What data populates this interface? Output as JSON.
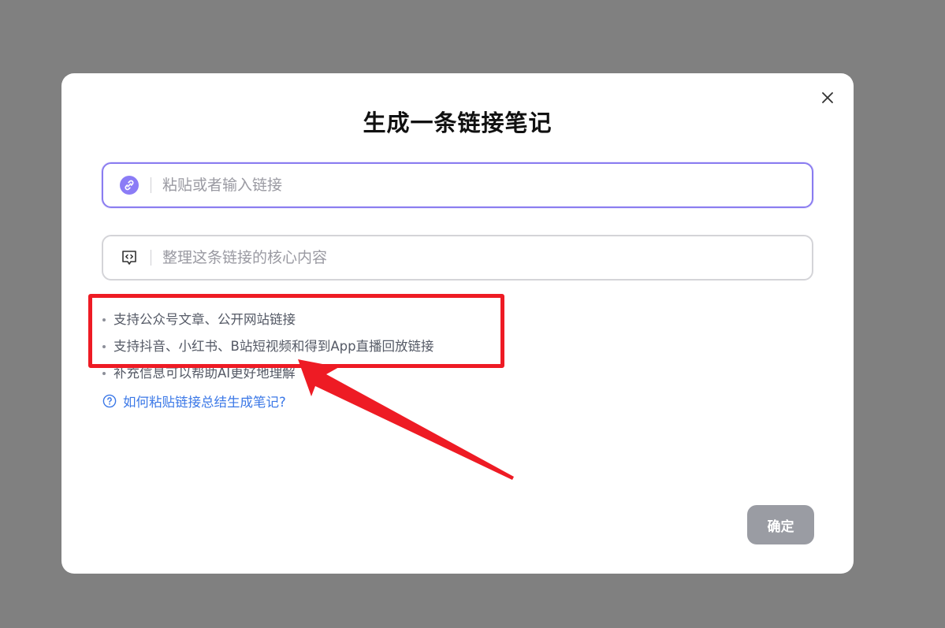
{
  "dialog": {
    "title": "生成一条链接笔记",
    "close_icon": "close-icon",
    "url_field": {
      "icon": "link-icon",
      "icon_color": "#8b7cf6",
      "placeholder": "粘贴或者输入链接",
      "value": ""
    },
    "note_field": {
      "icon": "code-note-icon",
      "placeholder": "整理这条链接的核心内容",
      "value": ""
    },
    "tips": [
      "支持公众号文章、公开网站链接",
      "支持抖音、小红书、B站短视频和得到App直播回放链接",
      "补充信息可以帮助AI更好地理解"
    ],
    "help_link": {
      "icon": "question-circle-icon",
      "label": "如何粘贴链接总结生成笔记?"
    },
    "confirm_label": "确定"
  },
  "annotation": {
    "color": "#ee1b24"
  },
  "colors": {
    "overlay": "#808080",
    "accent": "#8a7cf0",
    "link": "#3b78e7",
    "button_disabled": "#9a9ca3"
  }
}
